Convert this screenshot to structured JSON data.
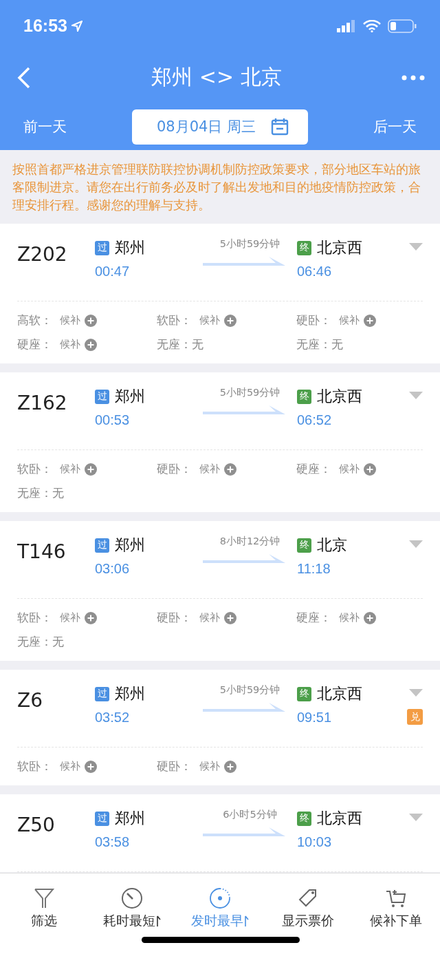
{
  "status_bar": {
    "time": "16:53"
  },
  "nav": {
    "title": "郑州 <> 北京"
  },
  "date_bar": {
    "prev": "前一天",
    "date": "08月04日 周三",
    "next": "后一天"
  },
  "notice": "按照首都严格进京管理联防联控协调机制防控政策要求，部分地区车站的旅客限制进京。请您在出行前务必及时了解出发地和目的地疫情防控政策，合理安排行程。感谢您的理解与支持。",
  "trains": [
    {
      "number": "Z202",
      "from_tag": {
        "text": "过",
        "color": "#4a90e2"
      },
      "from": "郑州",
      "depart": "00:47",
      "duration": "5小时59分钟",
      "to_tag": {
        "text": "终",
        "color": "#4c9f4a"
      },
      "to": "北京西",
      "arrive": "06:46",
      "seats": [
        {
          "label": "高软：",
          "value": "候补",
          "kind": "waitlist"
        },
        {
          "label": "软卧：",
          "value": "候补",
          "kind": "waitlist"
        },
        {
          "label": "硬卧：",
          "value": "候补",
          "kind": "waitlist"
        },
        {
          "label": "硬座：",
          "value": "候补",
          "kind": "waitlist"
        },
        {
          "label": "无座：",
          "value": "无",
          "kind": "none"
        },
        {
          "label": "无座：",
          "value": "无",
          "kind": "none"
        }
      ]
    },
    {
      "number": "Z162",
      "from_tag": {
        "text": "过",
        "color": "#4a90e2"
      },
      "from": "郑州",
      "depart": "00:53",
      "duration": "5小时59分钟",
      "to_tag": {
        "text": "终",
        "color": "#4c9f4a"
      },
      "to": "北京西",
      "arrive": "06:52",
      "seats": [
        {
          "label": "软卧：",
          "value": "候补",
          "kind": "waitlist"
        },
        {
          "label": "硬卧：",
          "value": "候补",
          "kind": "waitlist"
        },
        {
          "label": "硬座：",
          "value": "候补",
          "kind": "waitlist"
        },
        {
          "label": "无座：",
          "value": "无",
          "kind": "none"
        }
      ]
    },
    {
      "number": "T146",
      "from_tag": {
        "text": "过",
        "color": "#4a90e2"
      },
      "from": "郑州",
      "depart": "03:06",
      "duration": "8小时12分钟",
      "to_tag": {
        "text": "终",
        "color": "#4c9f4a"
      },
      "to": "北京",
      "arrive": "11:18",
      "seats": [
        {
          "label": "软卧：",
          "value": "候补",
          "kind": "waitlist"
        },
        {
          "label": "硬卧：",
          "value": "候补",
          "kind": "waitlist"
        },
        {
          "label": "硬座：",
          "value": "候补",
          "kind": "waitlist"
        },
        {
          "label": "无座：",
          "value": "无",
          "kind": "none"
        }
      ]
    },
    {
      "number": "Z6",
      "from_tag": {
        "text": "过",
        "color": "#4a90e2"
      },
      "from": "郑州",
      "depart": "03:52",
      "duration": "5小时59分钟",
      "to_tag": {
        "text": "终",
        "color": "#4c9f4a"
      },
      "to": "北京西",
      "arrive": "09:51",
      "badge": "兑",
      "seats": [
        {
          "label": "软卧：",
          "value": "候补",
          "kind": "waitlist"
        },
        {
          "label": "硬卧：",
          "value": "候补",
          "kind": "waitlist"
        }
      ]
    },
    {
      "number": "Z50",
      "from_tag": {
        "text": "过",
        "color": "#4a90e2"
      },
      "from": "郑州",
      "depart": "03:58",
      "duration": "6小时5分钟",
      "to_tag": {
        "text": "终",
        "color": "#4c9f4a"
      },
      "to": "北京西",
      "arrive": "10:03"
    }
  ],
  "tabs": [
    {
      "label": "筛选",
      "kind": "filter",
      "selected": false
    },
    {
      "label": "耗时最短",
      "kind": "timer",
      "selected": false
    },
    {
      "label": "发时最早",
      "kind": "clock24",
      "selected": true
    },
    {
      "label": "显示票价",
      "kind": "tag",
      "selected": false
    },
    {
      "label": "候补下单",
      "kind": "cart",
      "selected": false
    }
  ]
}
